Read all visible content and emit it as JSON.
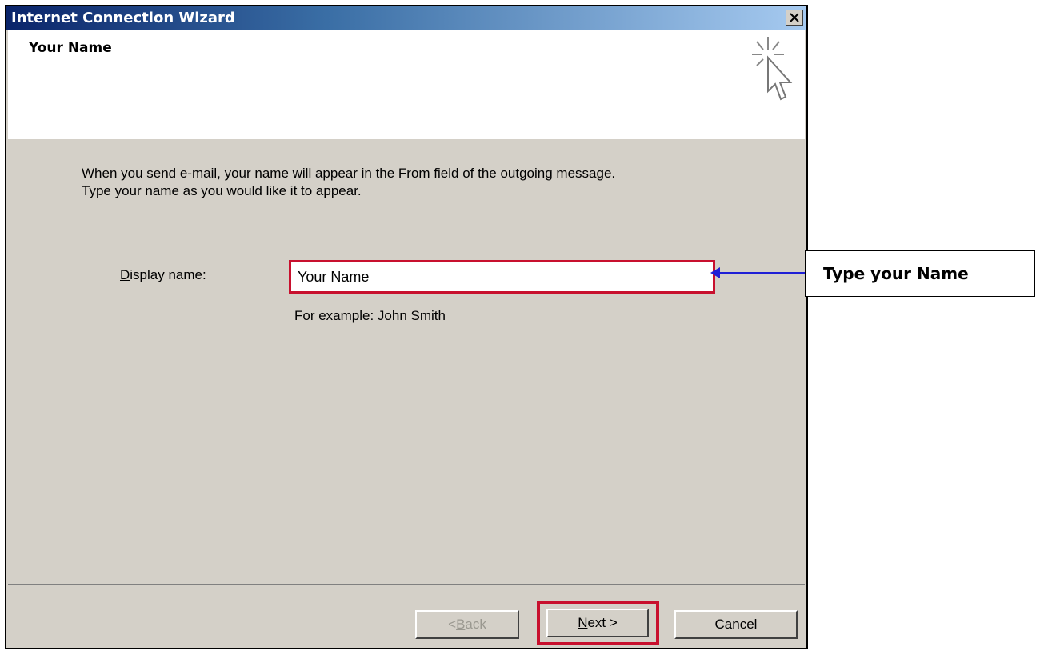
{
  "window": {
    "title": "Internet Connection Wizard",
    "close_symbol": "✕"
  },
  "header": {
    "title": "Your Name",
    "icon": "wizard-cursor-icon"
  },
  "description": {
    "line1": "When you send e-mail, your name will appear in the From field of the outgoing message.",
    "line2": "Type your name as you would like it to appear."
  },
  "form": {
    "display_name_label_prefix": "D",
    "display_name_label_rest": "isplay name:",
    "display_name_value": "Your Name",
    "example": "For example: John Smith"
  },
  "buttons": {
    "back_prefix": "< ",
    "back_access": "B",
    "back_rest": "ack",
    "next_access": "N",
    "next_rest": "ext >",
    "cancel": "Cancel"
  },
  "annotation": {
    "callout_text": "Type your Name",
    "highlight_color": "#c8102e",
    "arrow_color": "#1f1fd6"
  }
}
